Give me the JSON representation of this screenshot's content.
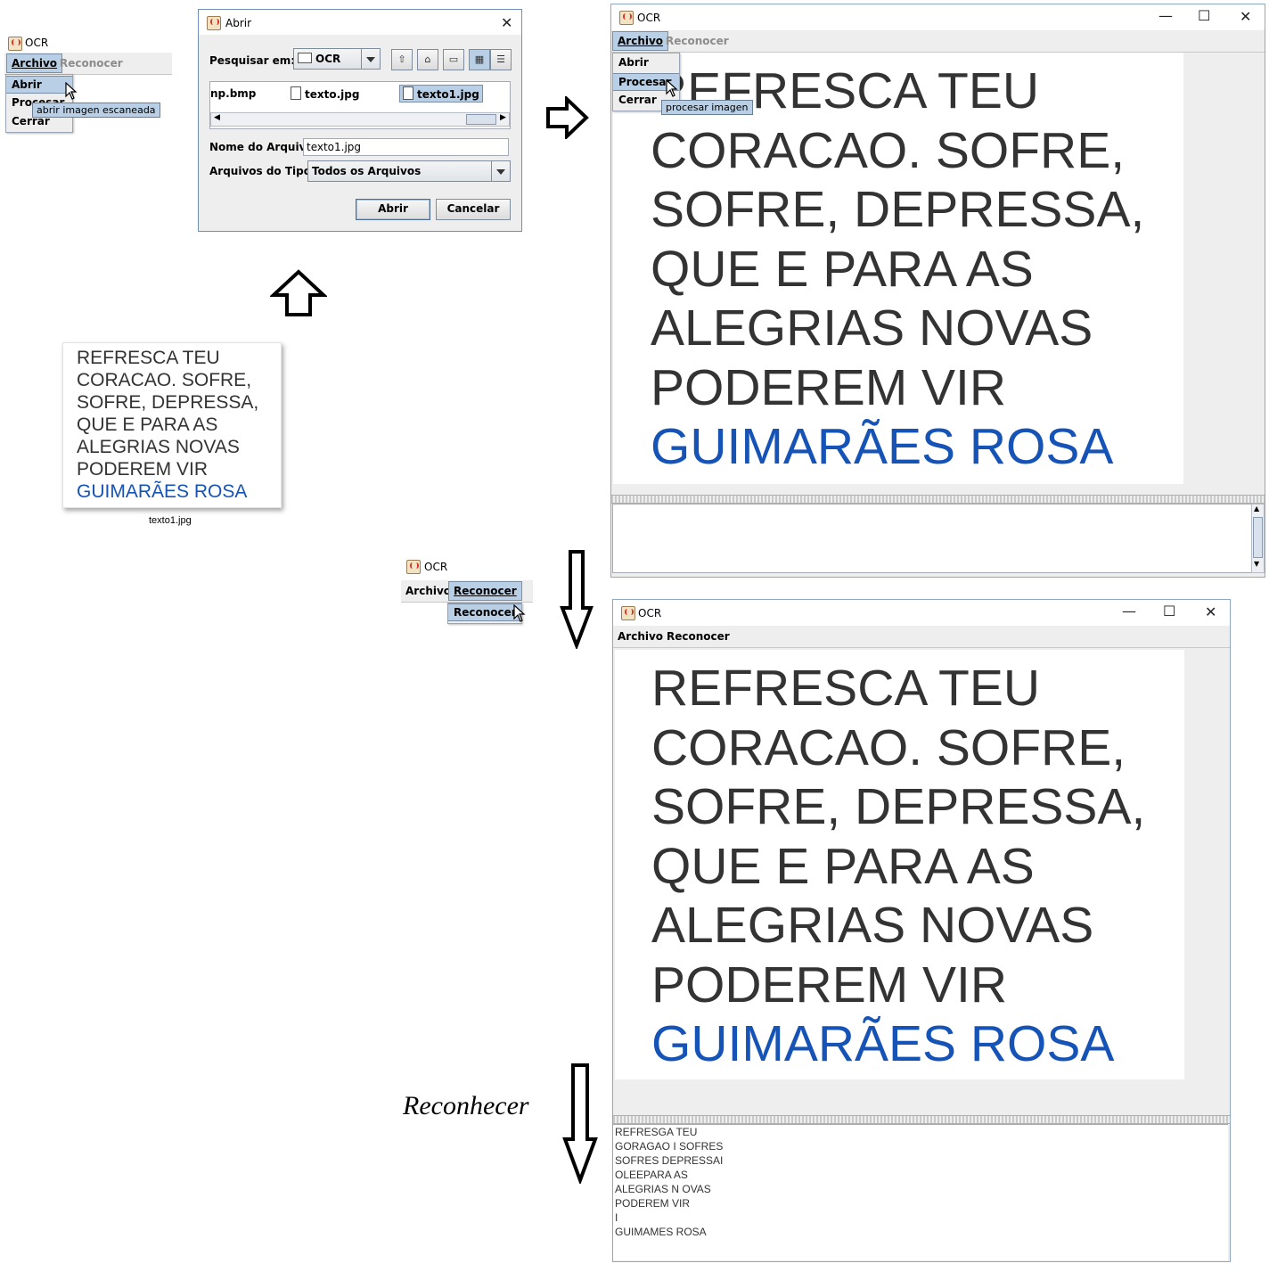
{
  "mini_menu_window": {
    "title": "OCR",
    "menus": [
      "Archivo",
      "Reconocer"
    ],
    "items": [
      "Abrir",
      "Procesar",
      "Cerrar"
    ],
    "tooltip": "abrir imagen escaneada"
  },
  "file_dialog": {
    "title": "Abrir",
    "look_in_label": "Pesquisar em:",
    "look_in_value": "OCR",
    "files": [
      "np.bmp",
      "texto.jpg",
      "texto1.jpg"
    ],
    "filename_label": "Nome do Arquivo:",
    "filename_value": "texto1.jpg",
    "filetype_label": "Arquivos do Tipo:",
    "filetype_value": "Todos os Arquivos",
    "open_button": "Abrir",
    "cancel_button": "Cancelar"
  },
  "image_preview": {
    "lines": [
      "REFRESCA TEU",
      "CORACAO. SOFRE,",
      "SOFRE, DEPRESSA,",
      "QUE E PARA AS",
      "ALEGRIAS NOVAS",
      "PODEREM VIR"
    ],
    "author": "GUIMARÃES ROSA",
    "filename": "texto1.jpg"
  },
  "ocr_window_top": {
    "title": "OCR",
    "menus": [
      "Archivo",
      "Reconocer"
    ],
    "items": [
      "Abrir",
      "Procesar",
      "Cerrar"
    ],
    "tooltip": "procesar imagen",
    "lines": [
      "REFRESCA TEU",
      "CORACAO. SOFRE,",
      "SOFRE, DEPRESSA,",
      "QUE E PARA AS",
      "ALEGRIAS NOVAS",
      "PODEREM VIR"
    ],
    "author": "GUIMARÃES ROSA"
  },
  "mini_reconocer_window": {
    "title": "OCR",
    "menus": [
      "Archivo",
      "Reconocer"
    ],
    "item": "Reconocer"
  },
  "ocr_window_bottom": {
    "title": "OCR",
    "menus": [
      "Archivo",
      "Reconocer"
    ],
    "lines": [
      "REFRESCA TEU",
      "CORACAO. SOFRE,",
      "SOFRE, DEPRESSA,",
      "QUE E PARA AS",
      "ALEGRIAS NOVAS",
      "PODEREM VIR"
    ],
    "author": "GUIMARÃES ROSA",
    "ocr_output": [
      "REFRESGA TEU",
      "GORAGAO I SOFRES",
      "SOFRES DEPRESSAI",
      "OLEEPARA AS",
      "ALEGRIAS N OVAS",
      "PODEREM VIR",
      "I",
      "GUIMAMES ROSA"
    ]
  },
  "annotation": {
    "reconhecer": "Reconhecer"
  },
  "window_controls": {
    "minimize": "—",
    "maximize": "☐",
    "close": "✕"
  }
}
